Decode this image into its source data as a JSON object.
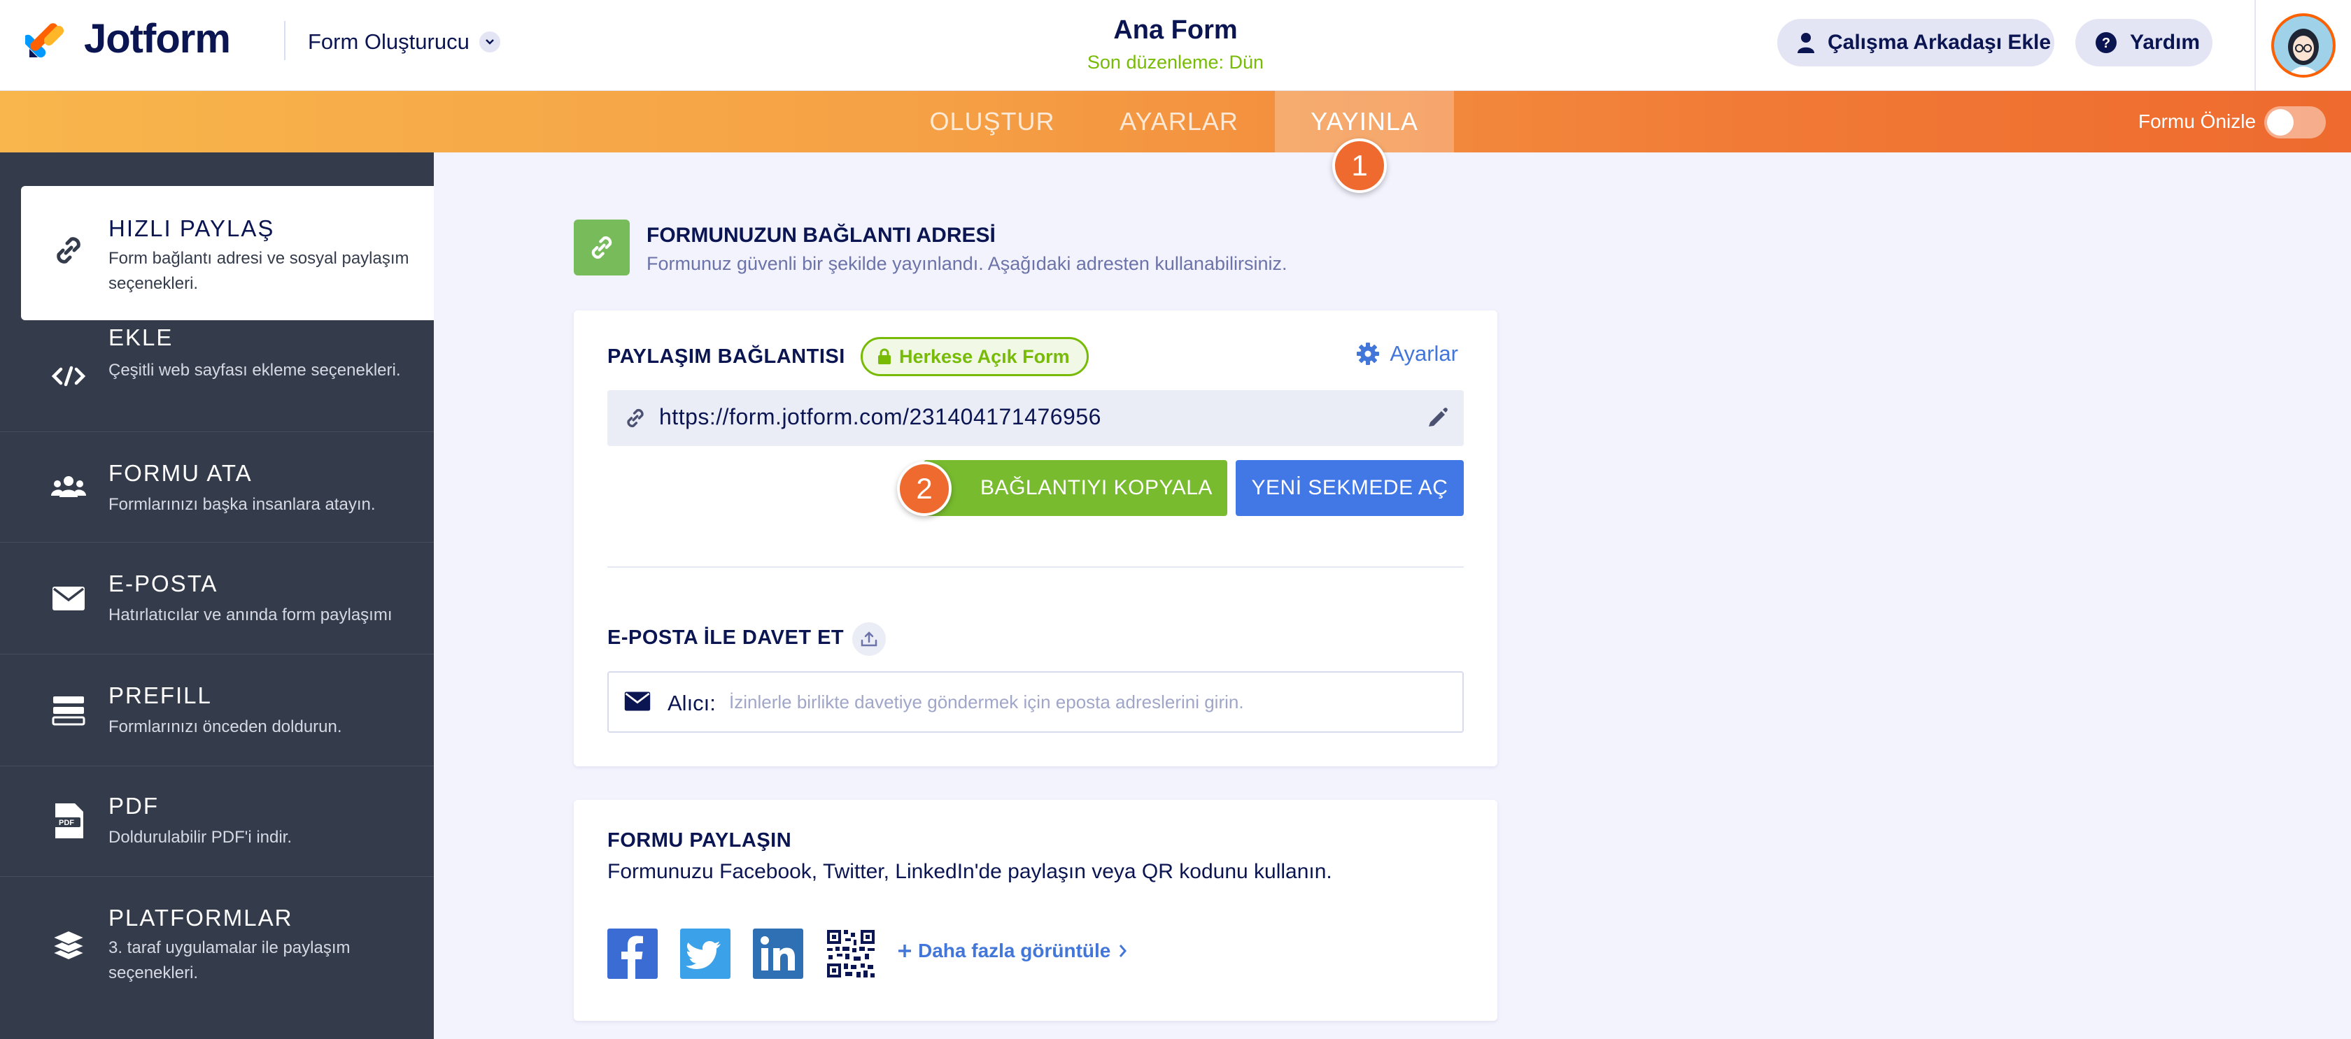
{
  "header": {
    "logo_text": "Jotform",
    "builder_label": "Form Oluşturucu",
    "form_title": "Ana Form",
    "last_edited": "Son düzenleme: Dün",
    "collaborator_button": "Çalışma Arkadaşı Ekle",
    "help_button": "Yardım"
  },
  "nav": {
    "tabs": [
      {
        "label": "OLUŞTUR"
      },
      {
        "label": "AYARLAR"
      },
      {
        "label": "YAYINLA",
        "active": true
      }
    ],
    "preview_label": "Formu Önizle",
    "preview_enabled": false
  },
  "badges": {
    "step1": "1",
    "step2": "2"
  },
  "sidebar": {
    "items": [
      {
        "title": "HIZLI PAYLAŞ",
        "desc": "Form bağlantı adresi ve sosyal paylaşım seçenekleri.",
        "icon": "link-icon",
        "active": true
      },
      {
        "title": "EKLE",
        "desc": "Çeşitli web sayfası ekleme seçenekleri.",
        "icon": "code-icon"
      },
      {
        "title": "FORMU ATA",
        "desc": "Formlarınızı başka insanlara atayın.",
        "icon": "users-icon"
      },
      {
        "title": "E-POSTA",
        "desc": "Hatırlatıcılar ve anında form paylaşımı",
        "icon": "envelope-icon"
      },
      {
        "title": "PREFILL",
        "desc": "Formlarınızı önceden doldurun.",
        "icon": "prefill-icon"
      },
      {
        "title": "PDF",
        "desc": "Doldurulabilir PDF'i indir.",
        "icon": "pdf-icon"
      },
      {
        "title": "PLATFORMLAR",
        "desc": "3. taraf uygulamalar ile paylaşım seçenekleri.",
        "icon": "layers-icon"
      }
    ]
  },
  "main": {
    "section_title": "FORMUNUZUN BAĞLANTI ADRESİ",
    "section_subtitle": "Formunuz güvenli bir şekilde yayınlandı. Aşağıdaki adresten kullanabilirsiniz.",
    "share_link": {
      "label": "PAYLAŞIM BAĞLANTISI",
      "visibility_badge": "Herkese Açık Form",
      "settings_link": "Ayarlar",
      "url": "https://form.jotform.com/231404171476956",
      "copy_button": "BAĞLANTIYI KOPYALA",
      "open_button": "YENİ SEKMEDE AÇ"
    },
    "email_invite": {
      "label": "E-POSTA İLE DAVET ET",
      "recipient_label": "Alıcı:",
      "placeholder": "İzinlerle birlikte davetiye göndermek için eposta adreslerini girin."
    },
    "share_form": {
      "title": "FORMU PAYLAŞIN",
      "description": "Formunuzu Facebook, Twitter, LinkedIn'de paylaşın veya QR kodunu kullanın.",
      "networks": [
        "facebook-icon",
        "twitter-icon",
        "linkedin-icon",
        "qr-code-icon"
      ],
      "more_link": "Daha fazla görüntüle"
    }
  },
  "colors": {
    "brand_orange": "#ff6100",
    "navy": "#0a1551",
    "green": "#78bb07",
    "blue": "#4277e6",
    "sidebar_bg": "#343c4c"
  }
}
